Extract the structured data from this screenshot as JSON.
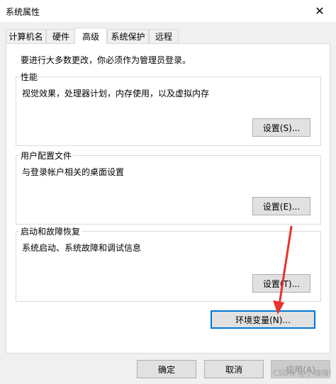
{
  "window": {
    "title": "系统属性",
    "close_glyph": "✕"
  },
  "tabs": [
    {
      "label": "计算机名"
    },
    {
      "label": "硬件"
    },
    {
      "label": "高级",
      "active": true
    },
    {
      "label": "系统保护"
    },
    {
      "label": "远程"
    }
  ],
  "admin_note": "要进行大多数更改，你必须作为管理员登录。",
  "groups": {
    "performance": {
      "label": "性能",
      "desc": "视觉效果，处理器计划，内存使用，以及虚拟内存",
      "button": "设置(S)..."
    },
    "user_profile": {
      "label": "用户配置文件",
      "desc": "与登录帐户相关的桌面设置",
      "button": "设置(E)..."
    },
    "startup": {
      "label": "启动和故障恢复",
      "desc": "系统启动、系统故障和调试信息",
      "button": "设置(T)..."
    }
  },
  "env_button": "环境变量(N)...",
  "footer": {
    "ok": "确定",
    "cancel": "取消",
    "apply": "应用(A)"
  },
  "watermark": "CSDN @小嗨嗨!",
  "colors": {
    "focus": "#0078d7",
    "arrow": "#e8322e"
  }
}
